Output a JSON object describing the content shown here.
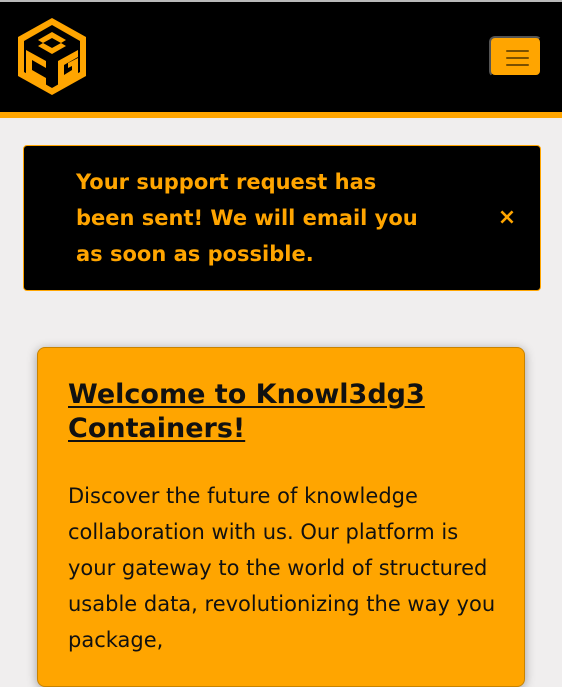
{
  "navbar": {
    "logo_icon": "cg-cube-logo-icon",
    "toggle_icon": "hamburger-menu-icon",
    "colors": {
      "background": "#000000",
      "accent": "#ffa500"
    }
  },
  "alert": {
    "message": "Your support request has been sent! We will email you as soon as possible.",
    "close_label": "×"
  },
  "welcome_card": {
    "title": "Welcome to Knowl3dg3 Containers!",
    "body": "Discover the future of knowledge collaboration with us. Our platform is your gateway to the world of structured usable data, revolutionizing the way you package,"
  }
}
